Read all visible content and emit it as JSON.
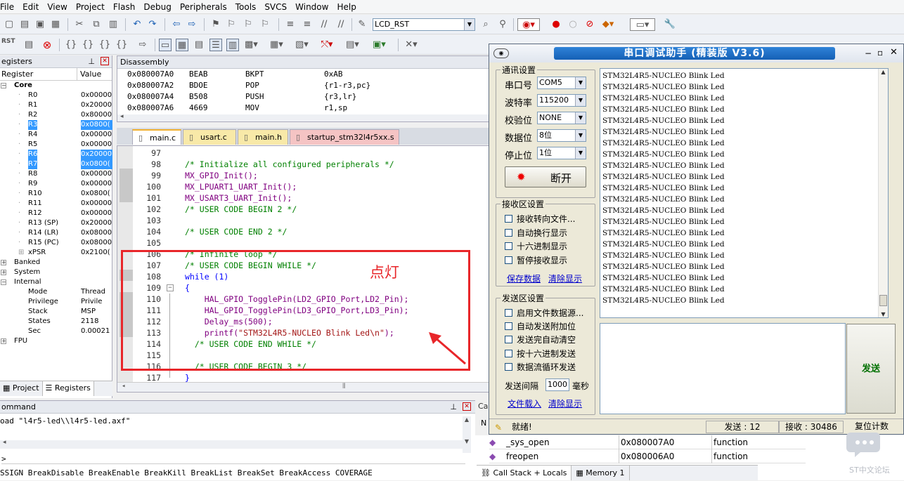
{
  "menu": [
    "File",
    "Edit",
    "View",
    "Project",
    "Flash",
    "Debug",
    "Peripherals",
    "Tools",
    "SVCS",
    "Window",
    "Help"
  ],
  "toolbar": {
    "target_combo": "LCD_RST",
    "rst_label": "RST"
  },
  "registers": {
    "title": "egisters",
    "col_register": "Register",
    "col_value": "Value",
    "group_core": "Core",
    "rows": [
      {
        "name": "R0",
        "value": "0x00000"
      },
      {
        "name": "R1",
        "value": "0x20000"
      },
      {
        "name": "R2",
        "value": "0x80000"
      },
      {
        "name": "R3",
        "value": "0x0800("
      },
      {
        "name": "R4",
        "value": "0x00000"
      },
      {
        "name": "R5",
        "value": "0x00000"
      },
      {
        "name": "R6",
        "value": "0x20000"
      },
      {
        "name": "R7",
        "value": "0x0800("
      },
      {
        "name": "R8",
        "value": "0x00000"
      },
      {
        "name": "R9",
        "value": "0x00000"
      },
      {
        "name": "R10",
        "value": "0x0800("
      },
      {
        "name": "R11",
        "value": "0x00000"
      },
      {
        "name": "R12",
        "value": "0x00000"
      },
      {
        "name": "R13 (SP)",
        "value": "0x20000"
      },
      {
        "name": "R14 (LR)",
        "value": "0x08000"
      },
      {
        "name": "R15 (PC)",
        "value": "0x08000"
      },
      {
        "name": "xPSR",
        "value": "0x2100("
      }
    ],
    "banked": "Banked",
    "system": "System",
    "internal": "Internal",
    "internal_rows": [
      {
        "name": "Mode",
        "value": "Thread"
      },
      {
        "name": "Privilege",
        "value": "Privile"
      },
      {
        "name": "Stack",
        "value": "MSP"
      },
      {
        "name": "States",
        "value": "2118"
      },
      {
        "name": "Sec",
        "value": "0.00021"
      }
    ],
    "fpu": "FPU",
    "tab_project": "Project",
    "tab_registers": "Registers"
  },
  "disassembly": {
    "title": "Disassembly",
    "lines": [
      {
        "addr": "0x080007A0",
        "hex": "BEAB",
        "op": "BKPT",
        "args": "0xAB"
      },
      {
        "addr": "0x080007A2",
        "hex": "BDOE",
        "op": "POP",
        "args": "{r1-r3,pc}"
      },
      {
        "addr": "0x080007A4",
        "hex": "B508",
        "op": "PUSH",
        "args": "{r3,lr}"
      },
      {
        "addr": "0x080007A6",
        "hex": "4669",
        "op": "MOV",
        "args": "r1,sp"
      }
    ]
  },
  "editor": {
    "tabs": [
      "main.c",
      "usart.c",
      "main.h",
      "startup_stm32l4r5xx.s"
    ],
    "lines": [
      {
        "n": "97",
        "t": "",
        "c": ""
      },
      {
        "n": "98",
        "t": "/* Initialize all configured peripherals */",
        "c": "cm"
      },
      {
        "n": "99",
        "t": "MX_GPIO_Init();",
        "c": "fn"
      },
      {
        "n": "100",
        "t": "MX_LPUART1_UART_Init();",
        "c": "fn"
      },
      {
        "n": "101",
        "t": "MX_USART3_UART_Init();",
        "c": "fn"
      },
      {
        "n": "102",
        "t": "/* USER CODE BEGIN 2 */",
        "c": "cm"
      },
      {
        "n": "103",
        "t": "",
        "c": ""
      },
      {
        "n": "104",
        "t": "/* USER CODE END 2 */",
        "c": "cm"
      },
      {
        "n": "105",
        "t": "",
        "c": ""
      },
      {
        "n": "106",
        "t": "/* Infinite loop */",
        "c": "cm"
      },
      {
        "n": "107",
        "t": "/* USER CODE BEGIN WHILE */",
        "c": "cm"
      },
      {
        "n": "108",
        "t": "while (1)",
        "c": "kw"
      },
      {
        "n": "109",
        "t": "{",
        "c": "kw"
      },
      {
        "n": "110",
        "t": "    HAL_GPIO_TogglePin(LD2_GPIO_Port,LD2_Pin);",
        "c": "fn"
      },
      {
        "n": "111",
        "t": "    HAL_GPIO_TogglePin(LD3_GPIO_Port,LD3_Pin);",
        "c": "fn"
      },
      {
        "n": "112",
        "t": "    Delay_ms(500);",
        "c": "fn"
      },
      {
        "n": "113",
        "t": "    printf(\"STM32L4R5-NUCLEO Blink Led\\n\");",
        "c": "fn"
      },
      {
        "n": "114",
        "t": "  /* USER CODE END WHILE */",
        "c": "cm"
      },
      {
        "n": "115",
        "t": "",
        "c": ""
      },
      {
        "n": "116",
        "t": "  /* USER CODE BEGIN 3 */",
        "c": "cm"
      },
      {
        "n": "117",
        "t": "}",
        "c": "kw"
      }
    ],
    "annotation": "点灯"
  },
  "command": {
    "title": "ommand",
    "line1": "oad \"l4r5-led\\\\l4r5-led.axf\"",
    "prompt": ">",
    "hint": "SSIGN BreakDisable BreakEnable BreakKill BreakList BreakSet BreakAccess COVERAGE"
  },
  "serial": {
    "title": "串口调试助手 (精装版 V3.6)",
    "comm_group": "通讯设置",
    "port_label": "串口号",
    "port_value": "COM5",
    "baud_label": "波特率",
    "baud_value": "115200",
    "parity_label": "校验位",
    "parity_value": "NONE",
    "data_label": "数据位",
    "data_value": "8位",
    "stop_label": "停止位",
    "stop_value": "1位",
    "disconnect": "断开",
    "rx_group": "接收区设置",
    "rx_opts": [
      "接收转向文件...",
      "自动换行显示",
      "十六进制显示",
      "暂停接收显示"
    ],
    "save_data": "保存数据",
    "clear_display": "清除显示",
    "tx_group": "发送区设置",
    "tx_opts": [
      "启用文件数据源...",
      "自动发送附加位",
      "发送完自动清空",
      "按十六进制发送",
      "数据流循环发送"
    ],
    "interval_label": "发送间隔",
    "interval_value": "1000",
    "interval_unit": "毫秒",
    "load_file": "文件载入",
    "clear_display2": "清除显示",
    "send": "发送",
    "rx_line": "STM32L4R5-NUCLEO Blink Led",
    "status_ready": "就绪!",
    "sent": "发送 : 12",
    "received": "接收 : 30486",
    "reset_count": "复位计数"
  },
  "callstack": {
    "col_n": "N",
    "rows": [
      {
        "name": "_sys_open",
        "addr": "0x080007A0",
        "type": "function"
      },
      {
        "name": "freopen",
        "addr": "0x080006A0",
        "type": "function"
      }
    ],
    "tab_callstack": "Call Stack + Locals",
    "tab_memory": "Memory 1",
    "ca": "Ca"
  },
  "watermark": "ST中文论坛",
  "colors": {
    "highlight_box": "#e8262a",
    "title_blue": "#1f6fc8",
    "selection": "#3399ff"
  }
}
